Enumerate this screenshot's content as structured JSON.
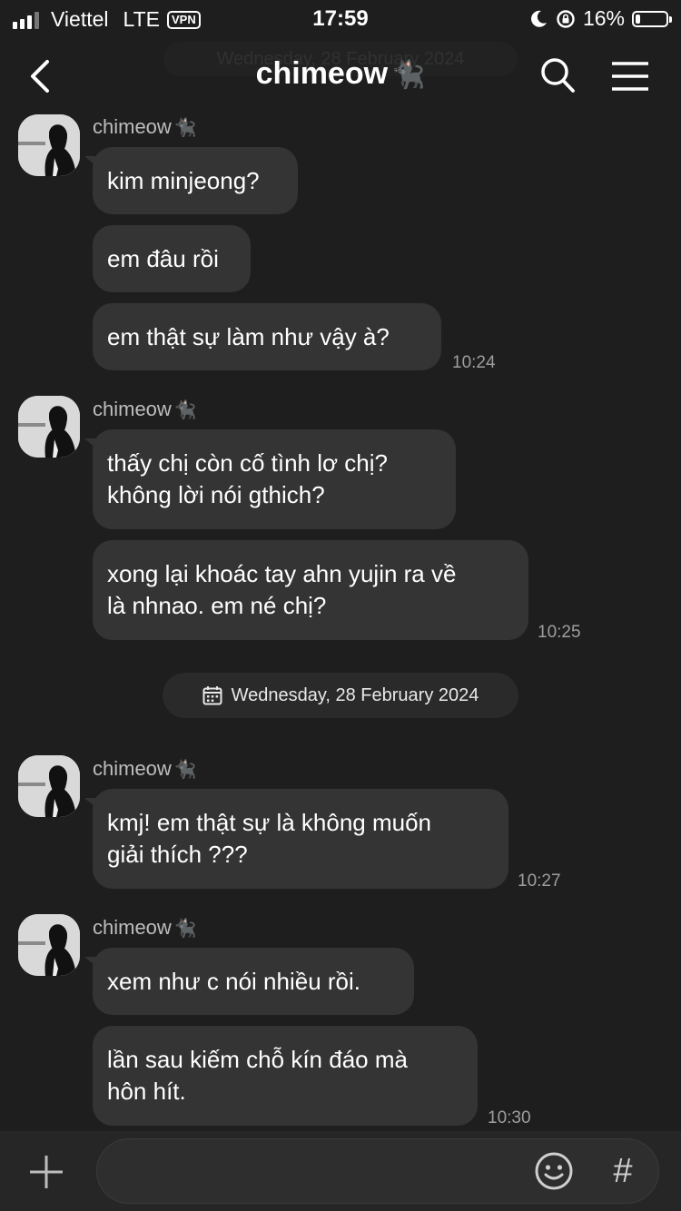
{
  "status_bar": {
    "carrier": "Viettel",
    "network": "LTE",
    "vpn": "VPN",
    "time": "17:59",
    "battery": "16%",
    "battery_level": 0.16
  },
  "header": {
    "title": "chimeow",
    "title_emoji": "🐈‍⬛",
    "ghost_date": "Wednesday, 28 February 2024"
  },
  "chat": {
    "groups": [
      {
        "sender": "chimeow",
        "sender_emoji": "🐈‍⬛",
        "messages": [
          {
            "text": "kim minjeong?",
            "time": ""
          },
          {
            "text": "em đâu rồi",
            "time": ""
          },
          {
            "text": "em thật sự làm như vậy à?",
            "time": "10:24"
          }
        ]
      },
      {
        "sender": "chimeow",
        "sender_emoji": "🐈‍⬛",
        "messages": [
          {
            "text": "thấy chị còn cố tình lơ chị?\nkhông lời nói gthich?",
            "time": ""
          },
          {
            "text": "xong lại khoác tay ahn yujin ra về\nlà nhnao. em né chị?",
            "time": "10:25"
          }
        ]
      },
      {
        "sender": "chimeow",
        "sender_emoji": "🐈‍⬛",
        "messages": [
          {
            "text": "kmj! em thật sự là không muốn\ngiải thích ???",
            "time": "10:27"
          }
        ]
      },
      {
        "sender": "chimeow",
        "sender_emoji": "🐈‍⬛",
        "messages": [
          {
            "text": "xem như c nói nhiều rồi.",
            "time": ""
          },
          {
            "text": "lần sau kiếm chỗ kín đáo mà\nhôn hít.",
            "time": "10:30"
          }
        ]
      }
    ],
    "date_separator": "Wednesday, 28 February 2024"
  },
  "input_bar": {
    "hash_label": "#",
    "message_value": ""
  },
  "icons": {
    "back": "back-chevron-icon",
    "search": "search-icon",
    "menu": "hamburger-menu-icon",
    "calendar": "calendar-icon",
    "plus": "plus-icon",
    "emoji": "emoji-smile-icon"
  },
  "colors": {
    "background": "#1e1e1e",
    "bubble": "#343434",
    "text": "#ffffff",
    "secondary_text": "#9e9e9e"
  }
}
